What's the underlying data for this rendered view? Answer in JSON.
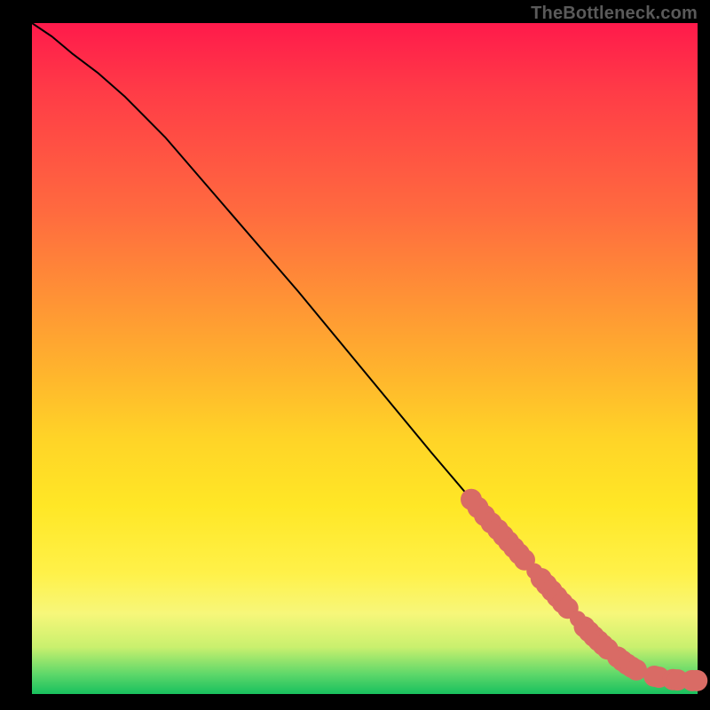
{
  "watermark": "TheBottleneck.com",
  "chart_data": {
    "type": "line",
    "title": "",
    "xlabel": "",
    "ylabel": "",
    "xlim": [
      0,
      100
    ],
    "ylim": [
      0,
      100
    ],
    "curve": {
      "x": [
        0,
        3,
        6,
        10,
        14,
        20,
        30,
        40,
        50,
        60,
        66,
        70,
        74,
        78,
        80,
        83,
        86,
        88,
        90,
        92,
        94,
        96,
        98,
        100
      ],
      "y": [
        100,
        98,
        95.5,
        92.5,
        89,
        83,
        71.5,
        60,
        48,
        36,
        29,
        24.5,
        20,
        15.5,
        13,
        10,
        7.5,
        6,
        4.5,
        3.5,
        2.8,
        2.3,
        2.1,
        2.0
      ]
    },
    "markers": [
      {
        "x": 66,
        "y": 29,
        "r": 1.6
      },
      {
        "x": 67,
        "y": 27.8,
        "r": 1.6
      },
      {
        "x": 68,
        "y": 26.6,
        "r": 1.6
      },
      {
        "x": 69,
        "y": 25.5,
        "r": 1.6
      },
      {
        "x": 70,
        "y": 24.5,
        "r": 1.6
      },
      {
        "x": 70.8,
        "y": 23.6,
        "r": 1.6
      },
      {
        "x": 71.6,
        "y": 22.7,
        "r": 1.6
      },
      {
        "x": 72.4,
        "y": 21.8,
        "r": 1.6
      },
      {
        "x": 73.2,
        "y": 20.9,
        "r": 1.6
      },
      {
        "x": 74,
        "y": 20,
        "r": 1.6
      },
      {
        "x": 75.5,
        "y": 18.3,
        "r": 1.2
      },
      {
        "x": 76.5,
        "y": 17.2,
        "r": 1.6
      },
      {
        "x": 77.3,
        "y": 16.3,
        "r": 1.6
      },
      {
        "x": 78.1,
        "y": 15.4,
        "r": 1.6
      },
      {
        "x": 78.9,
        "y": 14.5,
        "r": 1.6
      },
      {
        "x": 79.7,
        "y": 13.6,
        "r": 1.6
      },
      {
        "x": 80.5,
        "y": 12.8,
        "r": 1.6
      },
      {
        "x": 82,
        "y": 11.2,
        "r": 1.2
      },
      {
        "x": 83,
        "y": 10,
        "r": 1.6
      },
      {
        "x": 83.7,
        "y": 9.3,
        "r": 1.6
      },
      {
        "x": 84.4,
        "y": 8.6,
        "r": 1.6
      },
      {
        "x": 85.1,
        "y": 7.95,
        "r": 1.6
      },
      {
        "x": 85.8,
        "y": 7.3,
        "r": 1.6
      },
      {
        "x": 86.5,
        "y": 6.7,
        "r": 1.6
      },
      {
        "x": 88,
        "y": 5.5,
        "r": 1.6
      },
      {
        "x": 88.7,
        "y": 4.95,
        "r": 1.6
      },
      {
        "x": 89.4,
        "y": 4.45,
        "r": 1.6
      },
      {
        "x": 90.1,
        "y": 4.0,
        "r": 1.6
      },
      {
        "x": 90.8,
        "y": 3.6,
        "r": 1.6
      },
      {
        "x": 93.5,
        "y": 2.65,
        "r": 1.6
      },
      {
        "x": 94.2,
        "y": 2.5,
        "r": 1.6
      },
      {
        "x": 96.3,
        "y": 2.15,
        "r": 1.6
      },
      {
        "x": 97,
        "y": 2.1,
        "r": 1.6
      },
      {
        "x": 99.2,
        "y": 2.0,
        "r": 1.6
      },
      {
        "x": 99.9,
        "y": 2.0,
        "r": 1.6
      }
    ]
  }
}
